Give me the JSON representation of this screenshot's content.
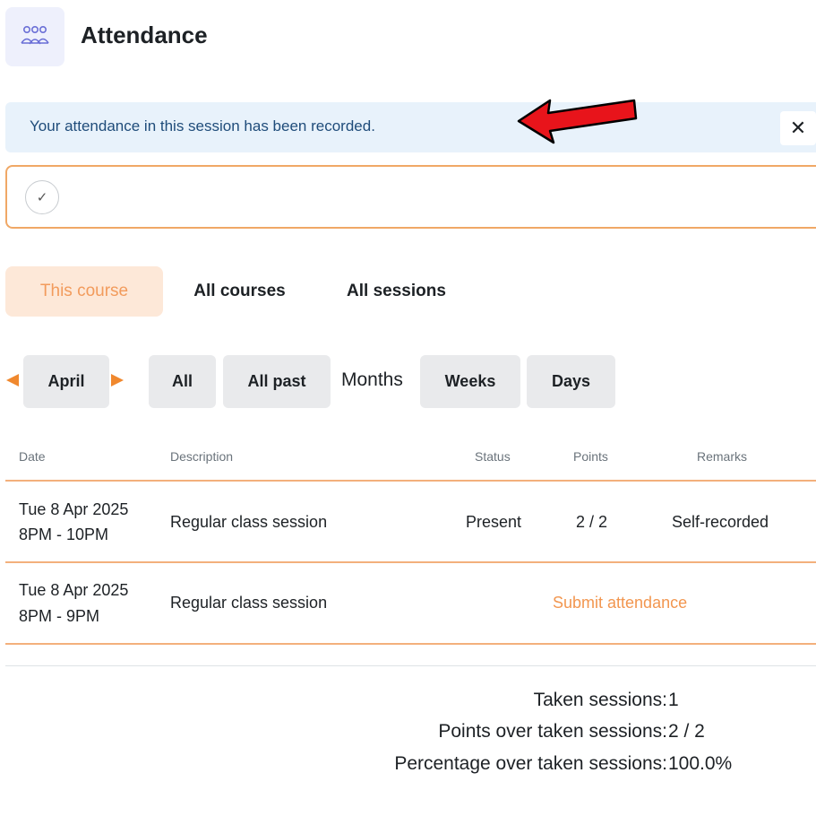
{
  "header": {
    "title": "Attendance",
    "icon": "users-icon",
    "icon_color": "#6a6fd6"
  },
  "notification": {
    "message": "Your attendance in this session has been recorded.",
    "close_label": "✕"
  },
  "completion": {
    "icon": "check-icon",
    "mark": "✓"
  },
  "tabs": [
    {
      "label": "This course",
      "active": true
    },
    {
      "label": "All courses",
      "active": false
    },
    {
      "label": "All sessions",
      "active": false
    }
  ],
  "period": {
    "current": "April",
    "buttons": [
      "All",
      "All past"
    ],
    "months_label": "Months",
    "buttons2": [
      "Weeks",
      "Days"
    ]
  },
  "table": {
    "headers": [
      "Date",
      "Description",
      "Status",
      "Points",
      "Remarks"
    ],
    "rows": [
      {
        "date": "Tue 8 Apr 2025",
        "time": "8PM - 10PM",
        "description": "Regular class session",
        "status": "Present",
        "points": "2 / 2",
        "remarks": "Self-recorded"
      },
      {
        "date": "Tue 8 Apr 2025",
        "time": "8PM - 9PM",
        "description": "Regular class session",
        "action": "Submit attendance"
      }
    ]
  },
  "summary": [
    {
      "label": "Taken sessions:",
      "value": "1"
    },
    {
      "label": "Points over taken sessions:",
      "value": "2 / 2"
    },
    {
      "label": "Percentage over taken sessions:",
      "value": "100.0%"
    }
  ],
  "colors": {
    "accent": "#f0882e",
    "notice_bg": "#e8f2fb",
    "arrow": "#e8141b"
  }
}
